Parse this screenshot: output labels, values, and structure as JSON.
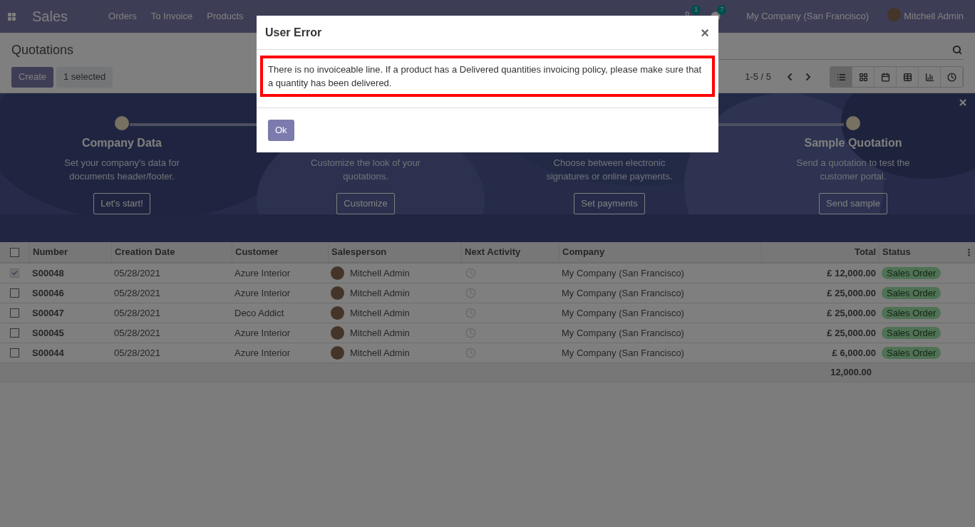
{
  "navbar": {
    "app": "Sales",
    "menu": [
      "Orders",
      "To Invoice",
      "Products"
    ],
    "activity_count": "1",
    "message_count": "7",
    "company": "My Company (San Francisco)",
    "user": "Mitchell Admin"
  },
  "control_panel": {
    "title": "Quotations",
    "create": "Create",
    "selection": "1 selected",
    "pager": "1-5 / 5",
    "views": [
      {
        "kind": "list",
        "selected": true
      },
      {
        "kind": "kanban",
        "selected": false
      },
      {
        "kind": "calendar",
        "selected": false
      },
      {
        "kind": "pivot",
        "selected": false
      },
      {
        "kind": "graph",
        "selected": false
      },
      {
        "kind": "activity",
        "selected": false
      }
    ]
  },
  "onboarding": {
    "steps": [
      {
        "title": "Company Data",
        "text": "Set your company's data for documents header/footer.",
        "button": "Let's start!"
      },
      {
        "text": "Customize the look of your quotations.",
        "button": "Customize"
      },
      {
        "text": "Choose between electronic signatures or online payments.",
        "button": "Set payments"
      },
      {
        "title": "Sample Quotation",
        "text": "Send a quotation to test the customer portal.",
        "button": "Send sample"
      }
    ]
  },
  "table": {
    "all_checked": false,
    "columns": [
      "Number",
      "Creation Date",
      "Customer",
      "Salesperson",
      "Next Activity",
      "Company",
      "Total",
      "Status"
    ],
    "rows": [
      {
        "checked": true,
        "number": "S00048",
        "date": "05/28/2021",
        "customer": "Azure Interior",
        "salesperson": "Mitchell Admin",
        "company": "My Company (San Francisco)",
        "total": "£ 12,000.00",
        "status": "Sales Order"
      },
      {
        "checked": false,
        "number": "S00046",
        "date": "05/28/2021",
        "customer": "Azure Interior",
        "salesperson": "Mitchell Admin",
        "company": "My Company (San Francisco)",
        "total": "£ 25,000.00",
        "status": "Sales Order"
      },
      {
        "checked": false,
        "number": "S00047",
        "date": "05/28/2021",
        "customer": "Deco Addict",
        "salesperson": "Mitchell Admin",
        "company": "My Company (San Francisco)",
        "total": "£ 25,000.00",
        "status": "Sales Order"
      },
      {
        "checked": false,
        "number": "S00045",
        "date": "05/28/2021",
        "customer": "Azure Interior",
        "salesperson": "Mitchell Admin",
        "company": "My Company (San Francisco)",
        "total": "£ 25,000.00",
        "status": "Sales Order"
      },
      {
        "checked": false,
        "number": "S00044",
        "date": "05/28/2021",
        "customer": "Azure Interior",
        "salesperson": "Mitchell Admin",
        "company": "My Company (San Francisco)",
        "total": "£ 6,000.00",
        "status": "Sales Order"
      }
    ],
    "sum": "12,000.00"
  },
  "dialog": {
    "title": "User Error",
    "close": "×",
    "message": "There is no invoiceable line. If a product has a Delivered quantities invoicing policy, please make sure that a quantity has been delivered.",
    "button": "Ok"
  }
}
